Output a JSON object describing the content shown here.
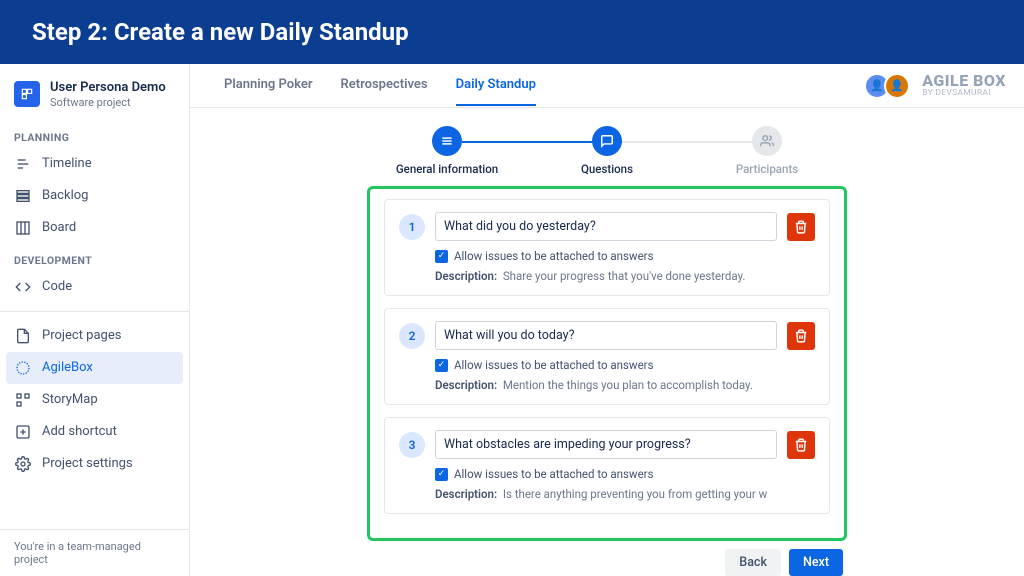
{
  "banner_title": "Step 2: Create a new Daily Standup",
  "project": {
    "name": "User Persona Demo",
    "type": "Software project",
    "icon_letter": "U"
  },
  "sections": {
    "planning": {
      "label": "PLANNING",
      "items": [
        "Timeline",
        "Backlog",
        "Board"
      ]
    },
    "development": {
      "label": "DEVELOPMENT",
      "items": [
        "Code"
      ]
    },
    "other": {
      "items": [
        "Project pages",
        "AgileBox",
        "StoryMap",
        "Add shortcut",
        "Project settings"
      ]
    }
  },
  "footer_note": "You're in a team-managed project",
  "tabs": [
    "Planning Poker",
    "Retrospectives",
    "Daily Standup"
  ],
  "active_tab": 2,
  "brand": {
    "main": "AGILE BOX",
    "sub": "BY DEVSAMURAI"
  },
  "wizard": [
    "General information",
    "Questions",
    "Participants"
  ],
  "allow_label": "Allow issues to be attached to answers",
  "desc_label": "Description:",
  "questions": [
    {
      "num": "1",
      "text": "What did you do yesterday?",
      "desc": "Share your progress that you've done yesterday."
    },
    {
      "num": "2",
      "text": "What will you do today?",
      "desc": "Mention the things you plan to accomplish today."
    },
    {
      "num": "3",
      "text": "What obstacles are impeding your progress?",
      "desc": "Is there anything preventing you from getting your w"
    }
  ],
  "buttons": {
    "back": "Back",
    "next": "Next"
  }
}
